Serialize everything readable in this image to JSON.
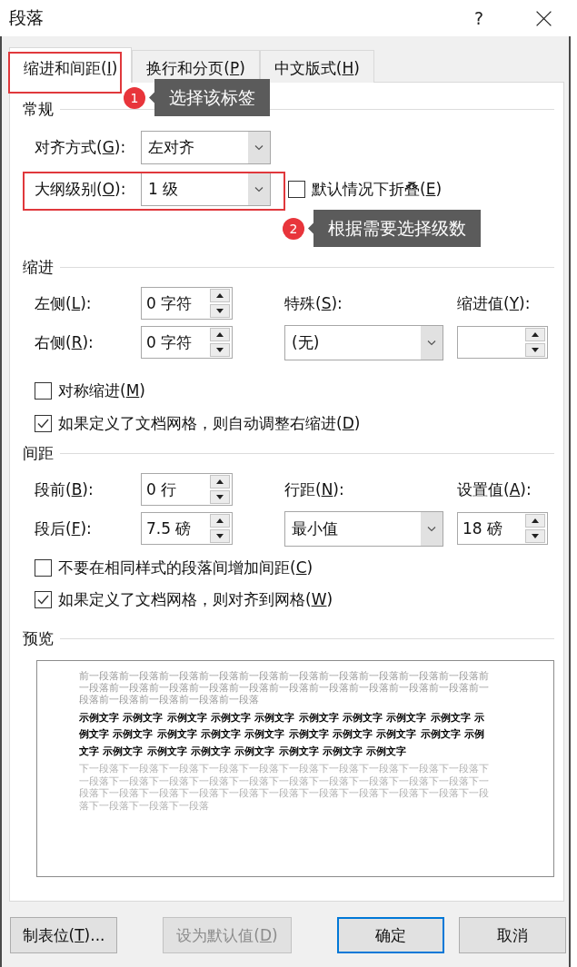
{
  "window": {
    "title": "段落",
    "help_button": "?"
  },
  "tabs": [
    {
      "label": "缩进和间距(I)",
      "selected": true,
      "highlighted": true,
      "callout": {
        "number": "1",
        "text": "选择该标签"
      }
    },
    {
      "label": "换行和分页(P)",
      "selected": false,
      "highlighted": false
    },
    {
      "label": "中文版式(H)",
      "selected": false,
      "highlighted": false
    }
  ],
  "general": {
    "heading": "常规",
    "alignment": {
      "label": "对齐方式(G):",
      "value": "左对齐"
    },
    "outline_level": {
      "label": "大纲级别(O):",
      "value": "1 级",
      "highlighted": true,
      "callout": {
        "number": "2",
        "text": "根据需要选择级数"
      }
    },
    "collapse": {
      "label": "默认情况下折叠(E)",
      "checked": false
    }
  },
  "indentation": {
    "heading": "缩进",
    "left": {
      "label": "左侧(L):",
      "value": "0 字符"
    },
    "right": {
      "label": "右侧(R):",
      "value": "0 字符"
    },
    "special": {
      "label": "特殊(S):",
      "value": "(无)"
    },
    "by": {
      "label": "缩进值(Y):"
    },
    "options": [
      {
        "label": "对称缩进(M)",
        "checked": false
      },
      {
        "label": "如果定义了文档网格，则自动调整右缩进(D)",
        "checked": true
      }
    ]
  },
  "spacing": {
    "heading": "间距",
    "before": {
      "label": "段前(B):",
      "value": "0 行"
    },
    "after": {
      "label": "段后(F):",
      "value": "7.5 磅"
    },
    "line_spacing": {
      "label": "行距(N):",
      "value": "最小值"
    },
    "at": {
      "label": "设置值(A):",
      "value": "18 磅"
    },
    "options": [
      {
        "label": "不要在相同样式的段落间增加间距(C)",
        "checked": false
      },
      {
        "label": "如果定义了文档网格，则对齐到网格(W)",
        "checked": true
      }
    ]
  },
  "preview": {
    "heading": "预览",
    "previous_paragraph": "前一段落前一段落前一段落前一段落前一段落前一段落前一段落前一段落前一段落前一段落前一段落前一段落前一段落前一段落前一段落前一段落前一段落前一段落前一段落前一段落前一段落前一段落前一段落前一段落前一段落",
    "sample_text": "示例文字 示例文字 示例文字 示例文字 示例文字 示例文字 示例文字 示例文字 示例文字 示例文字 示例文字 示例文字 示例文字 示例文字 示例文字 示例文字 示例文字 示例文字 示例文字 示例文字 示例文字 示例文字 示例文字 示例文字 示例文字 示例文字",
    "next_paragraph": "下一段落下一段落下一段落下一段落下一段落下一段落下一段落下一段落下一段落下一段落下一段落下一段落下一段落下一段落下一段落下一段落下一段落下一段落下一段落下一段落下一段落下一段落下一段落下一段落下一段落下一段落下一段落下一段落下一段落下一段落下一段落下一段落下一段落下一段落"
  },
  "buttons": [
    {
      "label": "制表位(T)...",
      "disabled": false,
      "default": false
    },
    {
      "label": "设为默认值(D)",
      "disabled": true,
      "default": false
    },
    {
      "label": "确定",
      "disabled": false,
      "default": true
    },
    {
      "label": "取消",
      "disabled": false,
      "default": false
    }
  ]
}
